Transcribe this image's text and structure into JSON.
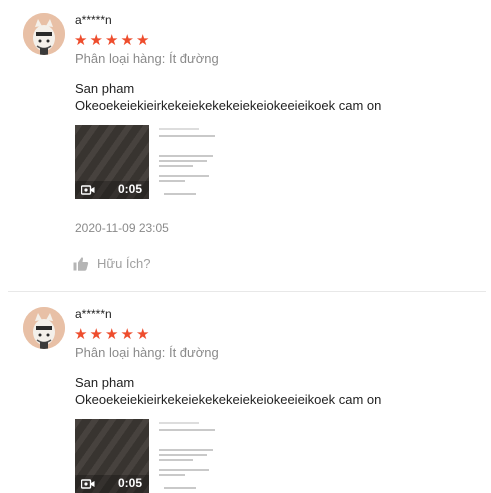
{
  "reviews": [
    {
      "username": "a*****n",
      "stars": [
        "★",
        "★",
        "★",
        "★",
        "★"
      ],
      "variation": "Phân loại hàng: Ít đường",
      "content_line1": "San pham",
      "content_line2": "Okeoekeiekieirkekeiekekekeiekeiokeeieikoek cam on",
      "video_duration": "0:05",
      "timestamp": "2020-11-09 23:05",
      "helpful_label": "Hữu Ích?"
    },
    {
      "username": "a*****n",
      "stars": [
        "★",
        "★",
        "★",
        "★",
        "★"
      ],
      "variation": "Phân loại hàng: Ít đường",
      "content_line1": "San pham",
      "content_line2": "Okeoekeiekieirkekeiekekekeiekeiokeeieikoek cam on",
      "video_duration": "0:05"
    }
  ],
  "colors": {
    "star": "#ee4d2d",
    "muted_text": "#8a8a8a",
    "text": "#222222"
  },
  "icons": [
    "avatar-image",
    "camera-icon",
    "thumbs-up-icon"
  ]
}
